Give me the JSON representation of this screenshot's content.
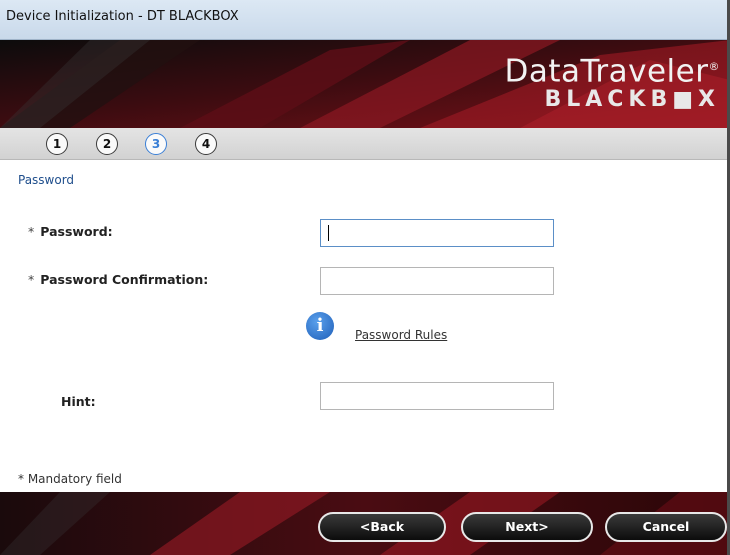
{
  "window": {
    "title": "Device Initialization - DT BLACKBOX"
  },
  "banner": {
    "brand_name": "DataTraveler",
    "brand_mark": "®",
    "brand_sub": "BLACKB■X"
  },
  "steps": {
    "items": [
      "1",
      "2",
      "3",
      "4"
    ],
    "active_index": 2,
    "active_color": "#3a7fd6"
  },
  "form": {
    "section_title": "Password",
    "asterisk": "*",
    "password_label": "Password:",
    "password_value": "",
    "confirm_label": "Password Confirmation:",
    "confirm_value": "",
    "rules_icon": "info-icon",
    "rules_link": "Password Rules",
    "hint_label": "Hint:",
    "hint_value": "",
    "mandatory_note": "* Mandatory field"
  },
  "footer": {
    "back_label": "<Back",
    "next_label": "Next>",
    "cancel_label": "Cancel"
  },
  "colors": {
    "section_title": "#1f4e8c",
    "banner_red": "#8a1620"
  }
}
